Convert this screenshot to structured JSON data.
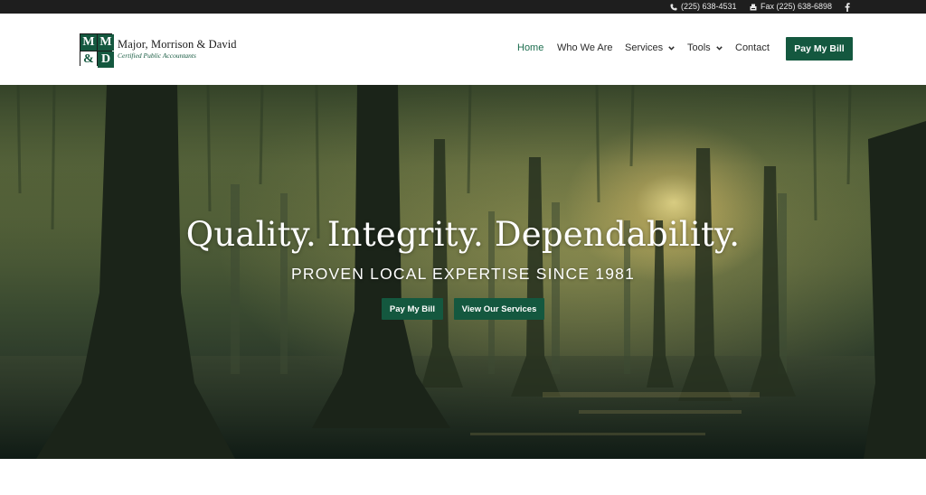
{
  "topbar": {
    "phone": "(225) 638-4531",
    "fax": "Fax (225) 638-6898",
    "icons": [
      "phone-icon",
      "fax-icon",
      "facebook-icon"
    ]
  },
  "logo": {
    "mark_letters": [
      "M",
      "M",
      "&",
      "D"
    ],
    "name": "Major, Morrison & David",
    "subtitle": "Certified Public Accountants"
  },
  "nav": {
    "items": [
      {
        "label": "Home",
        "active": true
      },
      {
        "label": "Who We Are"
      },
      {
        "label": "Services",
        "dropdown": true
      },
      {
        "label": "Tools",
        "dropdown": true
      },
      {
        "label": "Contact"
      }
    ],
    "cta": "Pay My Bill"
  },
  "hero": {
    "title": "Quality. Integrity. Dependability.",
    "subtitle": "PROVEN LOCAL EXPERTISE SINCE 1981",
    "buttons": {
      "pay": "Pay My Bill",
      "view": "View Our Services"
    }
  },
  "colors": {
    "brand_green": "#14583f",
    "active_nav": "#1d6e4f",
    "topbar_bg": "#1e1e1e"
  }
}
